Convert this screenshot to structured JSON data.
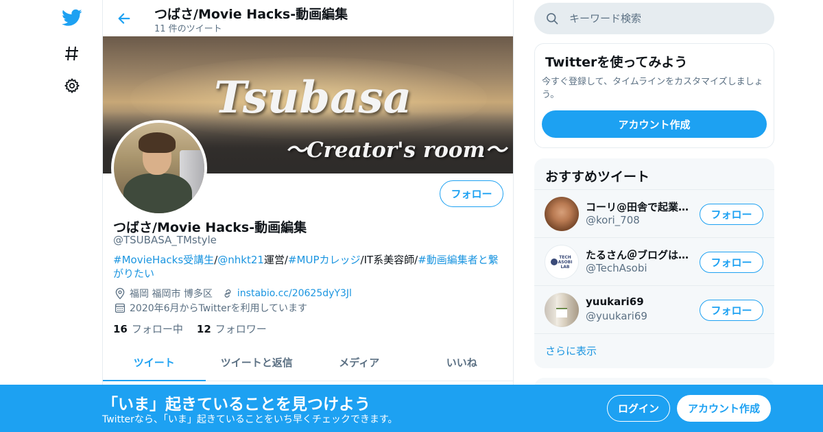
{
  "colors": {
    "accent": "#1da1f2",
    "link": "#1b95e0",
    "muted": "#5b7083",
    "border": "#e6ecf0"
  },
  "leftnav": {
    "icons": [
      "twitter-bird-icon",
      "hashtag-icon",
      "gear-icon"
    ]
  },
  "header": {
    "title": "つばさ/Movie Hacks-動画編集",
    "tweet_count": "11 件のツイート"
  },
  "banner": {
    "title": "Tsubasa",
    "subtitle": "〜Creator's room〜"
  },
  "profile": {
    "follow_label": "フォロー",
    "name": "つばさ/Movie Hacks-動画編集",
    "handle": "@TSUBASA_TMstyle",
    "bio": {
      "tag1": "#MovieHacks受講生",
      "sep1": "/",
      "mention": "@nhkt21",
      "text1": "運営/",
      "tag2": "#MUPカレッジ",
      "text2": "/IT系美容師/",
      "tag3": "#動画編集者と繋がりたい"
    },
    "location": "福岡 福岡市 博多区",
    "url": "instabio.cc/20625dyY3Jl",
    "joined": "2020年6月からTwitterを利用しています",
    "following_count": "16",
    "following_label": "フォロー中",
    "followers_count": "12",
    "followers_label": "フォロワー"
  },
  "tabs": [
    {
      "label": "ツイート",
      "active": true
    },
    {
      "label": "ツイートと返信",
      "active": false
    },
    {
      "label": "メディア",
      "active": false
    },
    {
      "label": "いいね",
      "active": false
    }
  ],
  "search": {
    "placeholder": "キーワード検索"
  },
  "signup_card": {
    "title": "Twitterを使ってみよう",
    "desc": "今すぐ登録して、タイムラインをカスタマイズしましょう。",
    "button": "アカウント作成"
  },
  "recommend": {
    "title": "おすすめツイート",
    "items": [
      {
        "name": "コーリ@田舎で起業しました",
        "handle": "@kori_708",
        "follow": "フォロー"
      },
      {
        "name": "たるさん＠ブログは資産",
        "handle": "@TechAsobi",
        "follow": "フォロー",
        "avatar_text": "TECH ASOBI LAB"
      },
      {
        "name": "yuukari69",
        "handle": "@yuukari69",
        "follow": "フォロー"
      }
    ],
    "more": "さらに表示"
  },
  "bottom_bar": {
    "title": "「いま」起きていることを見つけよう",
    "subtitle": "Twitterなら、「いま」起きていることをいち早くチェックできます。",
    "login": "ログイン",
    "signup": "アカウント作成"
  }
}
